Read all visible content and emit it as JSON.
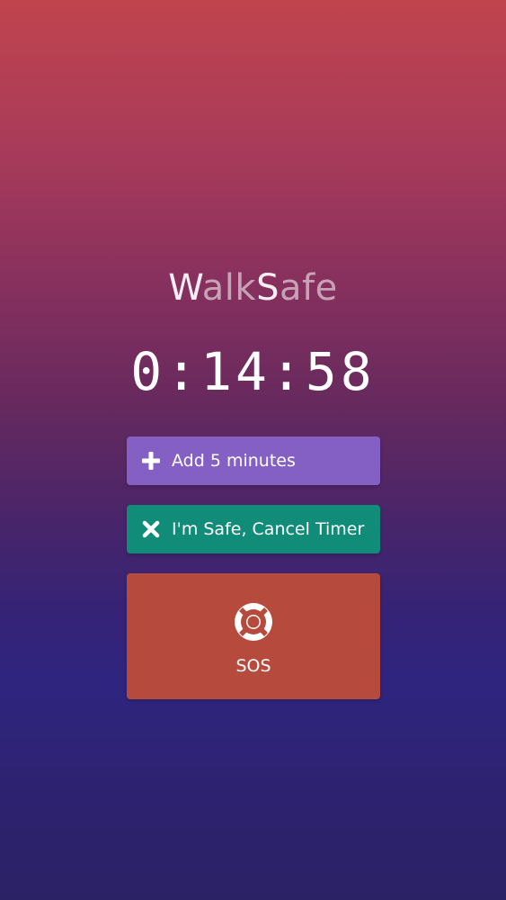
{
  "app": {
    "title_parts": [
      "W",
      "alk",
      "S",
      "afe"
    ]
  },
  "timer": {
    "display": "0:14:58"
  },
  "buttons": {
    "add_label": "Add 5 minutes",
    "add_icon": "plus-icon",
    "cancel_label": "I'm Safe, Cancel Timer",
    "cancel_icon": "close-icon",
    "sos_label": "SOS",
    "sos_icon": "lifebuoy-icon"
  },
  "colors": {
    "add_button": "#8460c4",
    "cancel_button": "#108c78",
    "sos_button": "#b54a3d",
    "background_top": "#c0444e",
    "background_bottom": "#2b2266"
  }
}
